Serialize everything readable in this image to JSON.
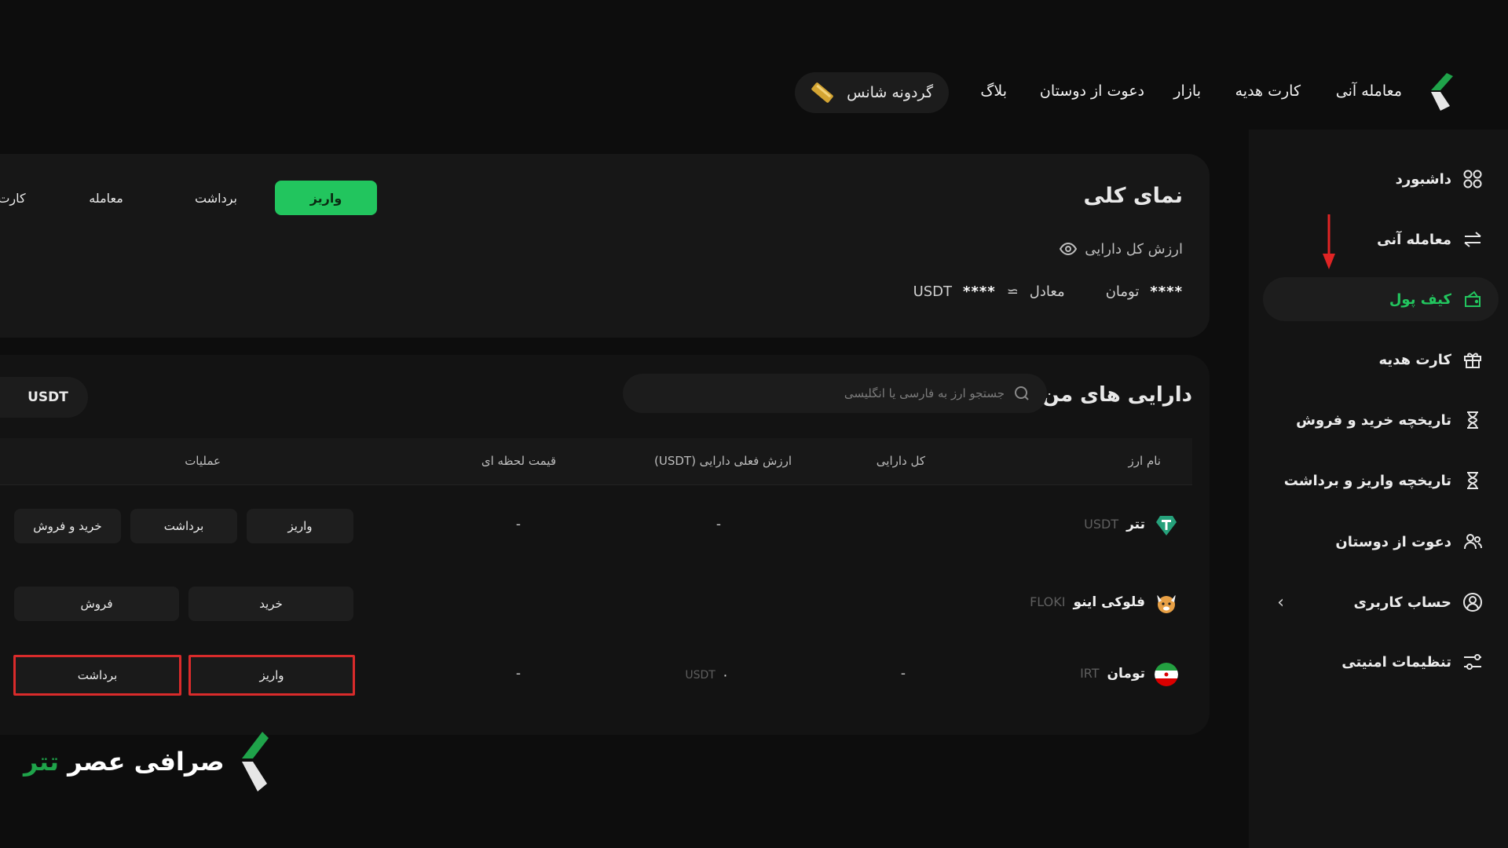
{
  "nav": {
    "items": [
      "معامله آنی",
      "کارت هدیه",
      "بازار",
      "دعوت از دوستان",
      "بلاگ"
    ],
    "lucky_wheel": "گردونه شانس",
    "logo_text": "عصر تتر"
  },
  "sidebar": {
    "items": [
      {
        "label": "داشبورد",
        "icon": "dashboard-icon"
      },
      {
        "label": "معامله آنی",
        "icon": "swap-icon"
      },
      {
        "label": "کیف پول",
        "icon": "wallet-icon",
        "active": true
      },
      {
        "label": "کارت هدیه",
        "icon": "gift-icon"
      },
      {
        "label": "تاریخچه خرید و فروش",
        "icon": "hourglass-icon"
      },
      {
        "label": "تاریخچه واریز و برداشت",
        "icon": "hourglass-icon"
      },
      {
        "label": "دعوت از دوستان",
        "icon": "users-icon"
      },
      {
        "label": "حساب کاربری",
        "icon": "user-icon"
      },
      {
        "label": "تنظیمات امنیتی",
        "icon": "sliders-icon"
      }
    ]
  },
  "overview": {
    "title": "نمای کلی",
    "total_label": "ارزش کل دارایی",
    "toman_stars": "****",
    "toman_label": "تومان",
    "equiv_label": "معادل",
    "approx": "≃",
    "usdt_stars": "****",
    "usdt_label": "USDT",
    "buttons": {
      "deposit": "واریز",
      "withdraw": "برداشت",
      "trade": "معامله",
      "card": "کارت"
    }
  },
  "assets": {
    "title": "دارایی های من",
    "search_placeholder": "جستجو ارز به فارسی یا انگلیسی",
    "currency_toggle": "USDT",
    "columns": {
      "name": "نام ارز",
      "total": "کل دارایی",
      "value": "ارزش فعلی دارایی (USDT)",
      "price": "قیمت لحظه ای",
      "ops": "عملیات"
    },
    "rows": [
      {
        "name": "تتر",
        "symbol": "USDT",
        "total": "",
        "value": "-",
        "price": "-",
        "actions": [
          "واریز",
          "برداشت",
          "خرید و فروش"
        ]
      },
      {
        "name": "فلوکی اینو",
        "symbol": "FLOKI",
        "total": "",
        "value": "",
        "price": "",
        "actions": [
          "خرید",
          "فروش"
        ]
      },
      {
        "name": "تومان",
        "symbol": "IRT",
        "total": "-",
        "value_num": "۰",
        "value_unit": "USDT",
        "price": "-",
        "actions": [
          "واریز",
          "برداشت"
        ]
      }
    ]
  },
  "brand": {
    "part1": "صرافی عصر",
    "part2": "تتر"
  },
  "colors": {
    "accent": "#22c55e",
    "highlight": "#d92b2b",
    "bg": "#0d0d0d"
  }
}
